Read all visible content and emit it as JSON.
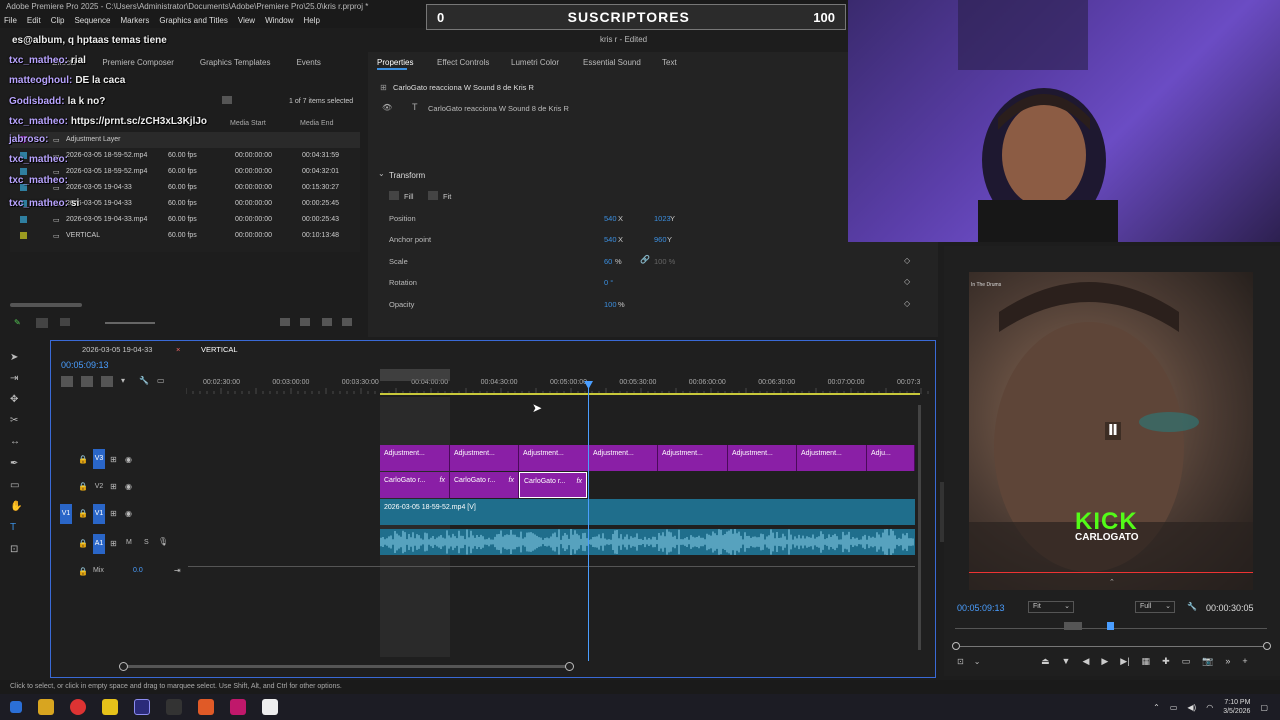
{
  "window": {
    "title": "Adobe Premiere Pro 2025 - C:\\Users\\Administrator\\Documents\\Adobe\\Premiere Pro\\25.0\\kris r.prproj *",
    "menu": [
      "File",
      "Edit",
      "Clip",
      "Sequence",
      "Markers",
      "Graphics and Titles",
      "View",
      "Window",
      "Help"
    ],
    "project_status": "kris r - Edited"
  },
  "overlay": {
    "subs_left": "0",
    "subs_label": "SUSCRIPTORES",
    "subs_right": "100"
  },
  "chat": [
    {
      "user": "",
      "text": "es@album, q hptaas temas tiene"
    },
    {
      "user": "txc_matheo:",
      "text": "rial"
    },
    {
      "user": "matteoghoul:",
      "text": "DE la caca"
    },
    {
      "user": "Godisbadd:",
      "text": "la k no?"
    },
    {
      "user": "txc_matheo:",
      "text": "https://prnt.sc/zCH3xL3KjlJo"
    },
    {
      "user": "jabroso:",
      "text": ""
    },
    {
      "user": "txc_matheo:",
      "text": ""
    },
    {
      "user": "txc_matheo:",
      "text": ""
    },
    {
      "user": "txc_matheo:",
      "text": "si"
    }
  ],
  "project": {
    "tabs": [
      "Effects",
      "Premiere Composer",
      "Graphics Templates",
      "Events"
    ],
    "selection_info": "1 of 7 items selected",
    "col_media_start": "Media Start",
    "col_media_end": "Media End",
    "rows": [
      {
        "name": "Adjustment Layer",
        "fps": "",
        "start": "",
        "end": ""
      },
      {
        "name": "2026-03-05 18-59-52.mp4",
        "fps": "60.00 fps",
        "start": "00:00:00:00",
        "end": "00:04:31:59"
      },
      {
        "name": "2026-03-05 18-59-52.mp4",
        "fps": "60.00 fps",
        "start": "00:00:00:00",
        "end": "00:04:32:01"
      },
      {
        "name": "2026-03-05 19-04-33",
        "fps": "60.00 fps",
        "start": "00:00:00:00",
        "end": "00:15:30:27"
      },
      {
        "name": "2026-03-05 19-04-33",
        "fps": "60.00 fps",
        "start": "00:00:00:00",
        "end": "00:00:25:45"
      },
      {
        "name": "2026-03-05 19-04-33.mp4",
        "fps": "60.00 fps",
        "start": "00:00:00:00",
        "end": "00:00:25:43"
      },
      {
        "name": "VERTICAL",
        "fps": "60.00 fps",
        "start": "00:00:00:00",
        "end": "00:10:13:48"
      }
    ]
  },
  "properties": {
    "tabs": [
      "Properties",
      "Effect Controls",
      "Lumetri Color",
      "Essential Sound",
      "Text"
    ],
    "clip_name": "CarloGato reacciona W Sound 8 de Kris R",
    "layer_name": "CarloGato reacciona W Sound 8 de Kris R",
    "section": "Transform",
    "fill": "Fill",
    "fit": "Fit",
    "position": {
      "label": "Position",
      "x": "540",
      "xunit": "X",
      "y": "1023",
      "yunit": "Y"
    },
    "anchor": {
      "label": "Anchor point",
      "x": "540",
      "xunit": "X",
      "y": "960",
      "yunit": "Y"
    },
    "scale": {
      "label": "Scale",
      "v": "60",
      "unit": "%",
      "v2": "100 %"
    },
    "rotation": {
      "label": "Rotation",
      "v": "0 °"
    },
    "opacity": {
      "label": "Opacity",
      "v": "100",
      "unit": "%"
    }
  },
  "timeline": {
    "tab1": "2026-03-05 19-04-33",
    "tab2": "VERTICAL",
    "timecode": "00:05:09:13",
    "ruler": [
      "00:02:30:00",
      "00:03:00:00",
      "00:03:30:00",
      "00:04:00:00",
      "00:04:30:00",
      "00:05:00:00",
      "00:05:30:00",
      "00:06:00:00",
      "00:06:30:00",
      "00:07:00:00",
      "00:07:3"
    ],
    "tracks": [
      "V3",
      "V2",
      "V1",
      "A1"
    ],
    "track_v1_src": "V1",
    "mix_label": "Mix",
    "mix_value": "0.0",
    "adjust_label": "Adjustment...",
    "adjust_short": "Adju...",
    "cg_label": "CarloGato r...",
    "v1_clip": "2026-03-05 18-59-52.mp4 [V]",
    "fx": "fx",
    "m": "M",
    "s": "S"
  },
  "program": {
    "timecode": "00:05:09:13",
    "fit": "Fit",
    "quality": "Full",
    "duration": "00:00:30:05",
    "brand_line1": "KICK",
    "brand_line2": "CARLOGATO",
    "corner_text": "In The Drums"
  },
  "status": {
    "hint": "Click to select, or click in empty space and drag to marquee select. Use Shift, Alt, and Ctrl for other options.",
    "time": "7:10 PM",
    "date": "3/5/2026"
  },
  "colors": {
    "accent": "#3b8fe0",
    "clip_purple": "#8a1fa6",
    "clip_teal": "#1f6e8c",
    "playhead": "#4a9eff",
    "chat_user": "#b9a4ff"
  }
}
